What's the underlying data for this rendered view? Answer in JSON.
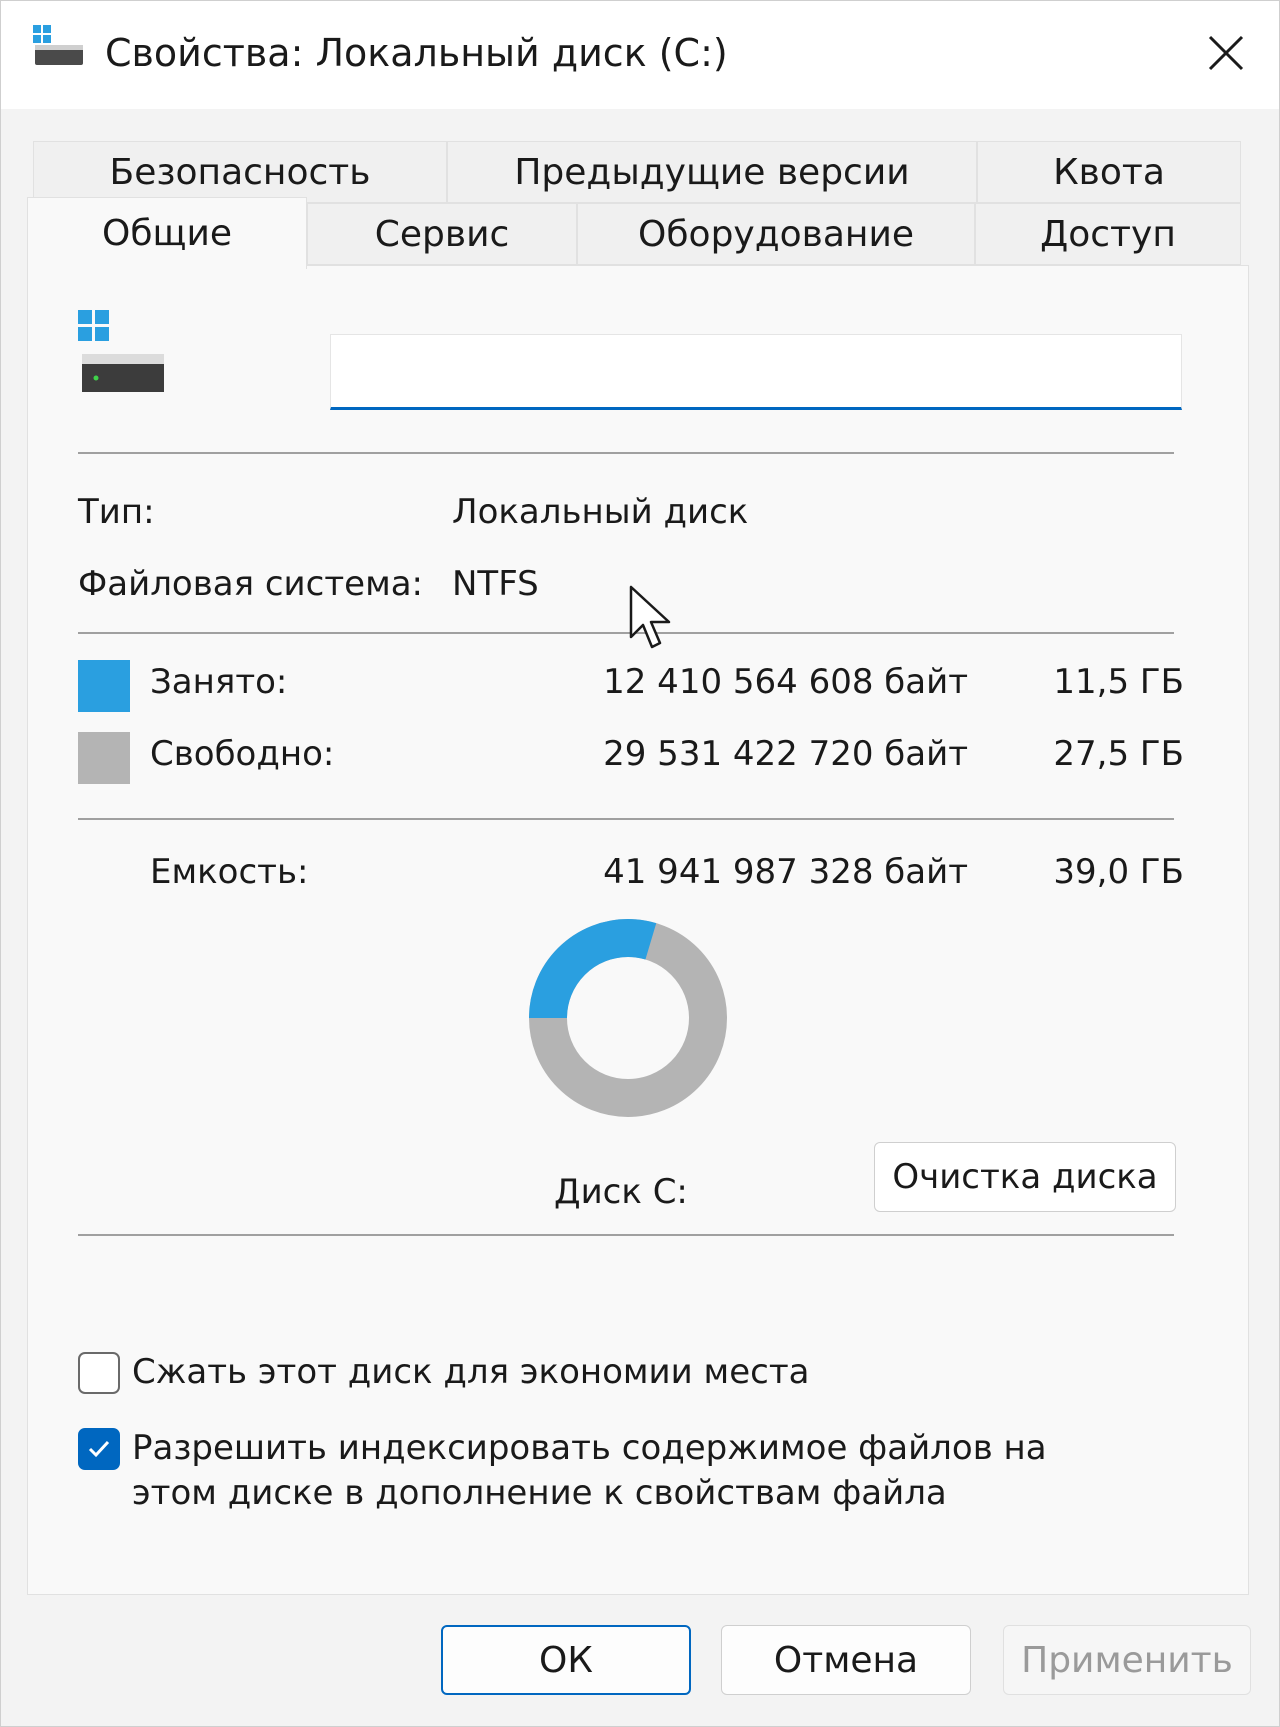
{
  "window": {
    "title": "Свойства: Локальный диск (C:)"
  },
  "tabs": {
    "row1": [
      "Безопасность",
      "Предыдущие версии",
      "Квота"
    ],
    "row2": [
      "Общие",
      "Сервис",
      "Оборудование",
      "Доступ"
    ],
    "active": "Общие"
  },
  "general": {
    "volume_name": "",
    "type_label": "Тип:",
    "type_value": "Локальный диск",
    "fs_label": "Файловая система:",
    "fs_value": "NTFS",
    "used_label": "Занято:",
    "used_bytes": "12 410 564 608 байт",
    "used_size": "11,5 ГБ",
    "free_label": "Свободно:",
    "free_bytes": "29 531 422 720 байт",
    "free_size": "27,5 ГБ",
    "capacity_label": "Емкость:",
    "capacity_bytes": "41 941 987 328 байт",
    "capacity_size": "39,0 ГБ",
    "drive_caption": "Диск C:",
    "cleanup_button": "Очистка диска",
    "used_fraction": 0.296,
    "compress_label": "Сжать этот диск для экономии места",
    "compress_checked": false,
    "index_label": "Разрешить индексировать содержимое файлов на этом диске в дополнение к свойствам файла",
    "index_checked": true
  },
  "footer": {
    "ok": "ОК",
    "cancel": "Отмена",
    "apply": "Применить"
  },
  "colors": {
    "used": "#2a9fe0",
    "free": "#b4b4b4",
    "accent": "#0067c0"
  }
}
